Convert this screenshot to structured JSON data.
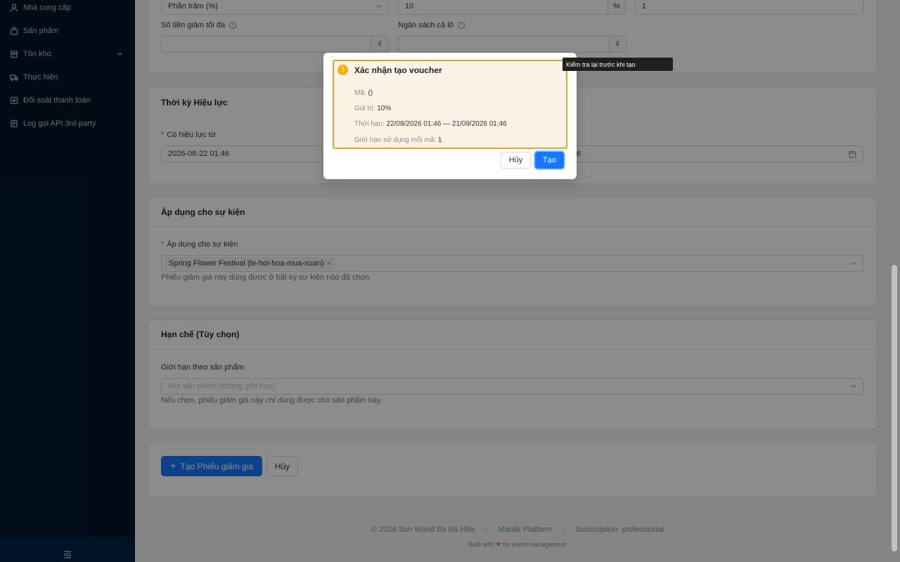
{
  "sidebar": {
    "items": [
      {
        "label": "Nhà cung cấp",
        "icon": "user-icon"
      },
      {
        "label": "Sản phẩm",
        "icon": "bag-icon"
      },
      {
        "label": "Tồn kho",
        "icon": "box-icon"
      },
      {
        "label": "Thực hiện",
        "icon": "truck-icon"
      },
      {
        "label": "Đối soát thanh toán",
        "icon": "ledger-icon"
      },
      {
        "label": "Log gọi API 3rd-party",
        "icon": "log-icon"
      }
    ]
  },
  "form": {
    "discount_type_value": "Phần trăm (%)",
    "discount_value": "10",
    "discount_value_suffix": "%",
    "usage_limit_value": "1",
    "max_discount_label": "Số tiền giảm tối đa",
    "max_discount_suffix": "₫",
    "batch_budget_label": "Ngân sách cả lô",
    "batch_budget_suffix": "₫"
  },
  "validity": {
    "title": "Thời kỳ Hiệu lực",
    "from_label": "Có hiệu lực từ",
    "from_value": "2026-08-22 01:46",
    "to_value_partial": "6"
  },
  "events": {
    "title": "Áp dụng cho sự kiện",
    "field_label": "Áp dụng cho sự kiện",
    "selected_tag": "Spring Flower Festival (le-hoi-hoa-mua-xuan)",
    "tag_close": "×",
    "help": "Phiếu giảm giá này dùng được ở bất kỳ sự kiện nào đã chọn."
  },
  "restrictions": {
    "title": "Hạn chế (Tùy chọn)",
    "product_label": "Giới hạn theo sản phẩm",
    "product_placeholder": "Mọi sản phẩm (không giới hạn)",
    "help": "Nếu chọn, phiếu giảm giá này chỉ dùng được cho sản phẩm này."
  },
  "actions": {
    "create_label": "Tạo Phiếu giảm giá",
    "create_icon": "+",
    "cancel_label": "Hủy"
  },
  "footer": {
    "copyright": "© 2026 Sun World Bà Nà Hills",
    "platform": "Mantik Platform",
    "subscription": "Subscription: professional",
    "built_prefix": "Built with",
    "heart": "❤",
    "built_suffix": "for event management"
  },
  "modal": {
    "warn_glyph": "!",
    "title": "Xác nhận tạo voucher",
    "rows": [
      {
        "key": "Mã:",
        "value": "()"
      },
      {
        "key": "Giá trị:",
        "value": "10%"
      },
      {
        "key": "Thời hạn:",
        "value": "22/08/2026 01:46 — 21/09/2026 01:46"
      },
      {
        "key": "Giới hạn sử dụng mỗi mã:",
        "value": "1"
      }
    ],
    "cancel_label": "Hủy",
    "ok_label": "Tạo"
  },
  "tooltip": "Kiểm tra lại trước khi tạo",
  "colors": {
    "primary": "#1677ff",
    "sidebar_bg": "#001529",
    "warning": "#faad14",
    "required": "#ff4d4f"
  }
}
